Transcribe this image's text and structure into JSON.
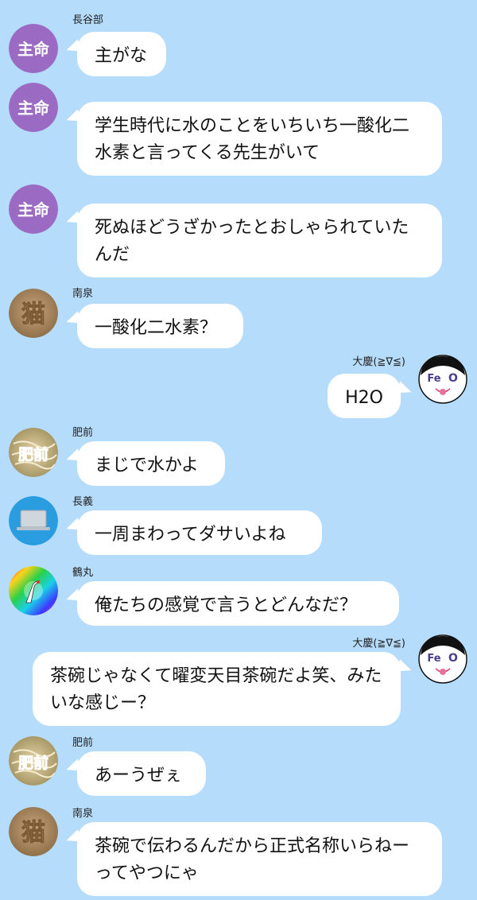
{
  "messages": [
    {
      "sender": "長谷部",
      "avatar": "seal-shumei-icon",
      "avatar_text": "主命",
      "text": "主がな"
    },
    {
      "sender": "",
      "avatar": "seal-shumei-icon",
      "avatar_text": "主命",
      "text": "学生時代に水のことをいちいち一酸化二水素と言ってくる先生がいて"
    },
    {
      "sender": "",
      "avatar": "seal-shumei-icon",
      "avatar_text": "主命",
      "text": "死ぬほどうざかったとおしゃられていたんだ"
    },
    {
      "sender": "南泉",
      "avatar": "cat-kanji-icon",
      "avatar_text": "猫",
      "text": "一酸化二水素？"
    },
    {
      "sender": "大慶(≧∇≦)",
      "avatar": "feo-face-icon",
      "avatar_text": "Fe O",
      "text": "H2O"
    },
    {
      "sender": "肥前",
      "avatar": "hizen-noodle-icon",
      "avatar_text": "肥前",
      "text": "まじで水かよ"
    },
    {
      "sender": "長義",
      "avatar": "laptop-icon",
      "avatar_text": "",
      "text": "一周まわってダサいよね"
    },
    {
      "sender": "鶴丸",
      "avatar": "crane-rainbow-icon",
      "avatar_text": "",
      "text": "俺たちの感覚で言うとどんなだ？"
    },
    {
      "sender": "大慶(≧∇≦)",
      "avatar": "feo-face-icon",
      "avatar_text": "Fe O",
      "text": "茶碗じゃなくて曜変天目茶碗だよ笑、みたいな感じー？"
    },
    {
      "sender": "肥前",
      "avatar": "hizen-noodle-icon",
      "avatar_text": "肥前",
      "text": "あーうぜぇ"
    },
    {
      "sender": "南泉",
      "avatar": "cat-kanji-icon",
      "avatar_text": "猫",
      "text": "茶碗で伝わるんだから正式名称いらねーってやつにゃ"
    }
  ],
  "colors": {
    "background": "#b6dcfb",
    "bubble": "#ffffff",
    "shumei_avatar": "#9b6bc4",
    "feo_text": "#4a3f8c"
  }
}
